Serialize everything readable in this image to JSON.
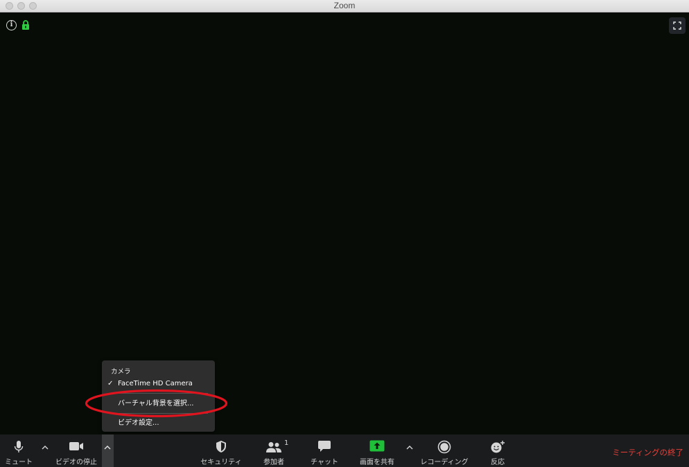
{
  "window": {
    "title": "Zoom"
  },
  "camera_menu": {
    "header": "カメラ",
    "items": [
      {
        "label": "FaceTime HD Camera",
        "checked": true
      },
      {
        "label": "バーチャル背景を選択..."
      },
      {
        "label": "ビデオ設定..."
      }
    ]
  },
  "toolbar": {
    "mute_label": "ミュート",
    "video_label": "ビデオの停止",
    "security_label": "セキュリティ",
    "participants_label": "参加者",
    "participants_count": "1",
    "chat_label": "チャット",
    "share_label": "画面を共有",
    "record_label": "レコーディング",
    "reactions_label": "反応",
    "end_label": "ミーティングの終了"
  },
  "colors": {
    "video_bg": "#070c07",
    "toolbar_bg": "#1b1c1e",
    "share_green": "#1fbf3a",
    "end_red": "#e8413a",
    "lock_green": "#2ecc40",
    "annotation_red": "#e0141e"
  }
}
